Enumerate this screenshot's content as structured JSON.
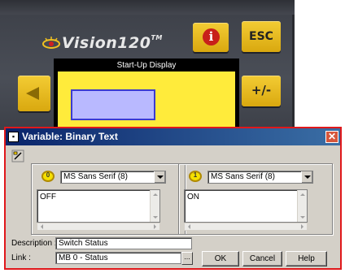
{
  "device": {
    "brand": "Vision120",
    "trademark": "TM",
    "keys": {
      "info_glyph": "i",
      "esc_label": "ESC",
      "left_icon": "left-arrow-icon",
      "plusminus_label": "+/-"
    },
    "screen": {
      "title": "Start-Up Display",
      "background": "#ffeb3b",
      "element_fill": "#b9b9ff"
    }
  },
  "dialog": {
    "title": "Variable: Binary Text",
    "close_glyph": "✕",
    "off_state": {
      "font": "MS Sans Serif (8)",
      "text": "OFF",
      "icon_glyph": "0"
    },
    "on_state": {
      "font": "MS Sans Serif (8)",
      "text": "ON",
      "icon_glyph": "1"
    },
    "description_label": "Description :",
    "description_value": "Switch Status",
    "link_label": "Link :",
    "link_value": "MB 0  - Status",
    "browse_label": "...",
    "ok_label": "OK",
    "cancel_label": "Cancel",
    "help_label": "Help"
  }
}
